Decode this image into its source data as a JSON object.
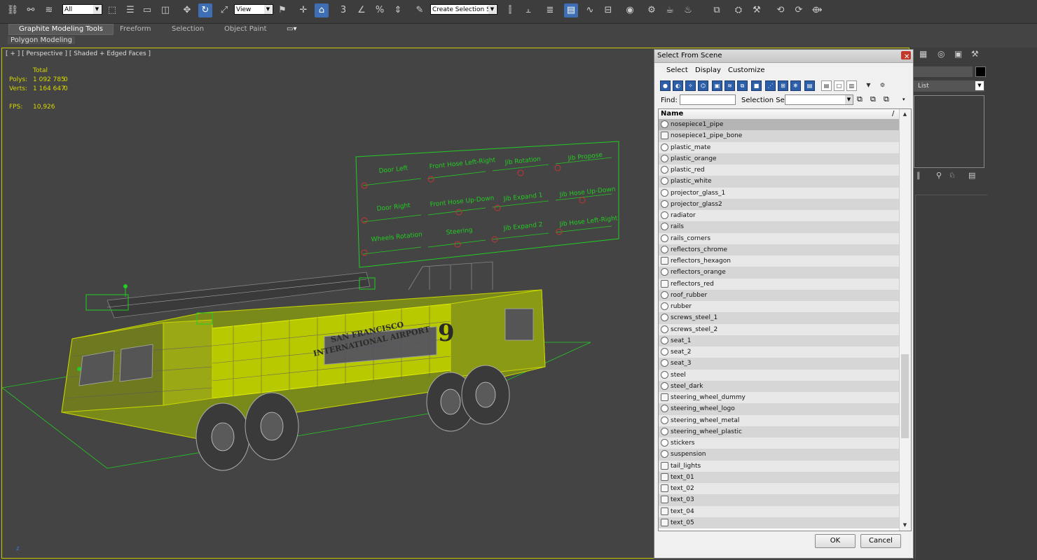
{
  "toolbar": {
    "filter_dropdown": "All",
    "view_dropdown": "View",
    "selection_set": "Create Selection Se"
  },
  "ribbon": {
    "tabs": [
      "Graphite Modeling Tools",
      "Freeform",
      "Selection",
      "Object Paint"
    ],
    "sub_label": "Polygon Modeling"
  },
  "viewport": {
    "label": "[ + ] [ Perspective ] [ Shaded + Edged Faces ]",
    "stats": {
      "total_label": "Total",
      "polys_label": "Polys:",
      "polys_value": "1 092 785",
      "polys_sel": "0",
      "verts_label": "Verts:",
      "verts_value": "1 164 647",
      "verts_sel": "0",
      "fps_label": "FPS:",
      "fps_value": "10,926"
    },
    "board_labels": [
      "Door Left",
      "Front Hose Left-Right",
      "Jib Rotation",
      "Jib Propose",
      "Door Right",
      "Front Hose Up-Down",
      "Jib Expand 1",
      "Jib Hose Up-Down",
      "Wheels Rotation",
      "Steering",
      "Jib Expand 2",
      "Jib Hose Left-Right"
    ],
    "truck_text": [
      "SAN FRANCISCO",
      "INTERNATIONAL AIRPORT",
      "9"
    ]
  },
  "right_panel": {
    "list_label": "List"
  },
  "dialog": {
    "title": "Select From Scene",
    "menu": [
      "Select",
      "Display",
      "Customize"
    ],
    "find_label": "Find:",
    "selection_set_label": "Selection Set:",
    "column_header": "Name",
    "items": [
      {
        "name": "nosepiece1_pipe",
        "type": "geometry",
        "selected": true
      },
      {
        "name": "nosepiece1_pipe_bone",
        "type": "bone",
        "selected": false
      },
      {
        "name": "plastic_mate",
        "type": "geometry",
        "selected": false
      },
      {
        "name": "plastic_orange",
        "type": "geometry",
        "selected": false
      },
      {
        "name": "plastic_red",
        "type": "geometry",
        "selected": false
      },
      {
        "name": "plastic_white",
        "type": "geometry",
        "selected": false
      },
      {
        "name": "projector_glass_1",
        "type": "geometry",
        "selected": false
      },
      {
        "name": "projector_glass2",
        "type": "geometry",
        "selected": false
      },
      {
        "name": "radiator",
        "type": "geometry",
        "selected": false
      },
      {
        "name": "rails",
        "type": "geometry",
        "selected": false
      },
      {
        "name": "rails_corners",
        "type": "geometry",
        "selected": false
      },
      {
        "name": "reflectors_chrome",
        "type": "geometry",
        "selected": false
      },
      {
        "name": "reflectors_hexagon",
        "type": "bone",
        "selected": false
      },
      {
        "name": "reflectors_orange",
        "type": "geometry",
        "selected": false
      },
      {
        "name": "reflectors_red",
        "type": "bone",
        "selected": false
      },
      {
        "name": "roof_rubber",
        "type": "geometry",
        "selected": false
      },
      {
        "name": "rubber",
        "type": "geometry",
        "selected": false
      },
      {
        "name": "screws_steel_1",
        "type": "geometry",
        "selected": false
      },
      {
        "name": "screws_steel_2",
        "type": "geometry",
        "selected": false
      },
      {
        "name": "seat_1",
        "type": "geometry",
        "selected": false
      },
      {
        "name": "seat_2",
        "type": "geometry",
        "selected": false
      },
      {
        "name": "seat_3",
        "type": "geometry",
        "selected": false
      },
      {
        "name": "steel",
        "type": "geometry",
        "selected": false
      },
      {
        "name": "steel_dark",
        "type": "geometry",
        "selected": false
      },
      {
        "name": "steering_wheel_dummy",
        "type": "bone",
        "selected": false
      },
      {
        "name": "steering_wheel_logo",
        "type": "geometry",
        "selected": false
      },
      {
        "name": "steering_wheel_metal",
        "type": "geometry",
        "selected": false
      },
      {
        "name": "steering_wheel_plastic",
        "type": "geometry",
        "selected": false
      },
      {
        "name": "stickers",
        "type": "geometry",
        "selected": false
      },
      {
        "name": "suspension",
        "type": "geometry",
        "selected": false
      },
      {
        "name": "tail_lights",
        "type": "bone",
        "selected": false
      },
      {
        "name": "text_01",
        "type": "bone",
        "selected": false
      },
      {
        "name": "text_02",
        "type": "bone",
        "selected": false
      },
      {
        "name": "text_03",
        "type": "bone",
        "selected": false
      },
      {
        "name": "text_04",
        "type": "bone",
        "selected": false
      },
      {
        "name": "text_05",
        "type": "bone",
        "selected": false
      }
    ],
    "ok_label": "OK",
    "cancel_label": "Cancel"
  },
  "colors": {
    "viewport_bg": "#444444",
    "wire_yellow": "#d8d800",
    "helper_green": "#22cc22",
    "selection_blue": "#2d5ea8"
  }
}
